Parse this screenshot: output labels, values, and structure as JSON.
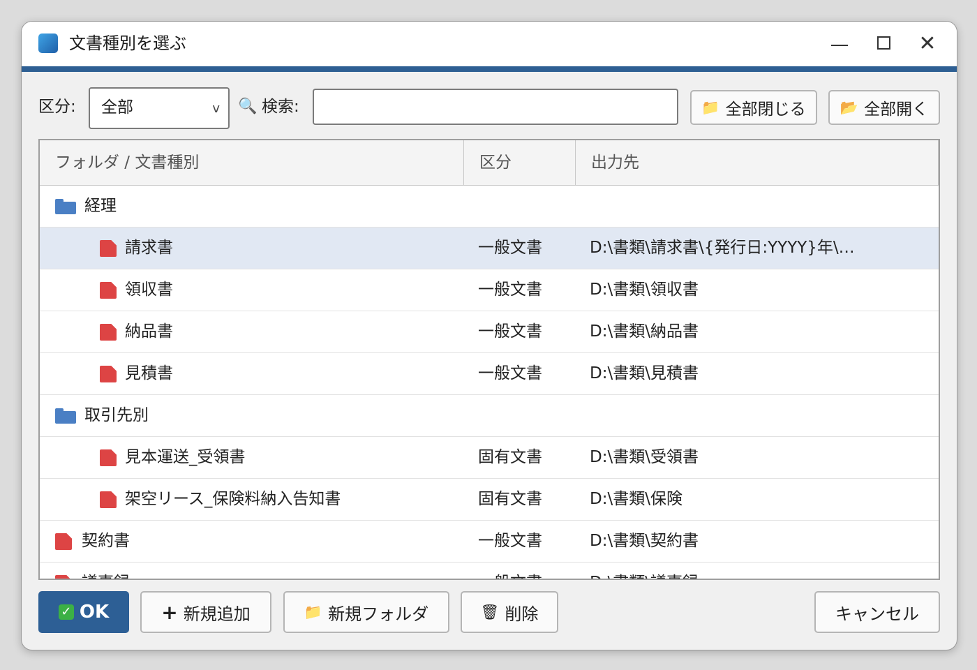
{
  "window": {
    "title": "文書種別を選ぶ",
    "minimize_glyph": "—",
    "close_glyph": "✕"
  },
  "toolbar": {
    "category_label": "区分:",
    "category_value": "全部",
    "category_chevron": "v",
    "search_label": "検索:",
    "search_icon": "🔍",
    "search_value": "",
    "collapse_all": "全部閉じる",
    "expand_all": "全部開く",
    "folder_closed_glyph": "📁",
    "folder_open_glyph": "📂"
  },
  "table": {
    "columns": [
      "フォルダ / 文書種別",
      "区分",
      "出力先"
    ],
    "rows": [
      {
        "type": "folder",
        "level": 0,
        "name": "経理",
        "kind": "",
        "dest": ""
      },
      {
        "type": "doc",
        "level": 1,
        "name": "請求書",
        "kind": "一般文書",
        "dest": "D:\\書類\\請求書\\{発行日:YYYY}年\\…",
        "selected": true
      },
      {
        "type": "doc",
        "level": 1,
        "name": "領収書",
        "kind": "一般文書",
        "dest": "D:\\書類\\領収書"
      },
      {
        "type": "doc",
        "level": 1,
        "name": "納品書",
        "kind": "一般文書",
        "dest": "D:\\書類\\納品書"
      },
      {
        "type": "doc",
        "level": 1,
        "name": "見積書",
        "kind": "一般文書",
        "dest": "D:\\書類\\見積書"
      },
      {
        "type": "folder",
        "level": 0,
        "name": "取引先別",
        "kind": "",
        "dest": ""
      },
      {
        "type": "doc",
        "level": 1,
        "name": "見本運送_受領書",
        "kind": "固有文書",
        "dest": "D:\\書類\\受領書"
      },
      {
        "type": "doc",
        "level": 1,
        "name": "架空リース_保険料納入告知書",
        "kind": "固有文書",
        "dest": "D:\\書類\\保険"
      },
      {
        "type": "doc",
        "level": 0,
        "name": "契約書",
        "kind": "一般文書",
        "dest": "D:\\書類\\契約書"
      },
      {
        "type": "doc",
        "level": 0,
        "name": "議事録",
        "kind": "一般文書",
        "dest": "D:\\書類\\議事録"
      }
    ]
  },
  "footer": {
    "ok_label": "OK",
    "ok_check": "✓",
    "add_icon": "+",
    "add_label": "新規追加",
    "new_folder_icon": "📁",
    "new_folder_label": "新規フォルダ",
    "delete_icon": "🗑",
    "delete_label": "削除",
    "cancel_label": "キャンセル"
  },
  "colors": {
    "accent": "#2e5f93",
    "selected_row": "#e1e8f3",
    "folder": "#4a7fc4",
    "document": "#dd4444"
  }
}
